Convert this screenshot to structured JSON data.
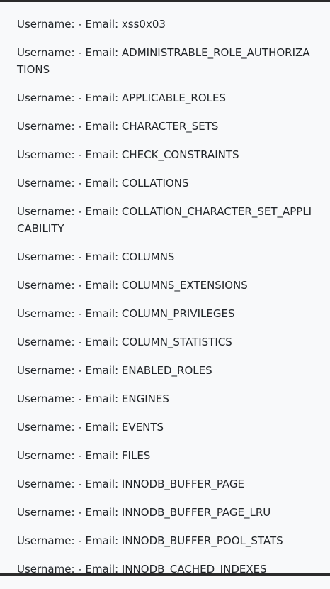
{
  "results": [
    {
      "text": "Username: - Email: xss0x03"
    },
    {
      "text": "Username: - Email: ADMINISTRABLE_ROLE_AUTHORIZATIONS"
    },
    {
      "text": "Username: - Email: APPLICABLE_ROLES"
    },
    {
      "text": "Username: - Email: CHARACTER_SETS"
    },
    {
      "text": "Username: - Email: CHECK_CONSTRAINTS"
    },
    {
      "text": "Username: - Email: COLLATIONS"
    },
    {
      "text": "Username: - Email: COLLATION_CHARACTER_SET_APPLICABILITY"
    },
    {
      "text": "Username: - Email: COLUMNS"
    },
    {
      "text": "Username: - Email: COLUMNS_EXTENSIONS"
    },
    {
      "text": "Username: - Email: COLUMN_PRIVILEGES"
    },
    {
      "text": "Username: - Email: COLUMN_STATISTICS"
    },
    {
      "text": "Username: - Email: ENABLED_ROLES"
    },
    {
      "text": "Username: - Email: ENGINES"
    },
    {
      "text": "Username: - Email: EVENTS"
    },
    {
      "text": "Username: - Email: FILES"
    },
    {
      "text": "Username: - Email: INNODB_BUFFER_PAGE"
    },
    {
      "text": "Username: - Email: INNODB_BUFFER_PAGE_LRU"
    },
    {
      "text": "Username: - Email: INNODB_BUFFER_POOL_STATS"
    },
    {
      "text": "Username: - Email: INNODB_CACHED_INDEXES"
    }
  ]
}
